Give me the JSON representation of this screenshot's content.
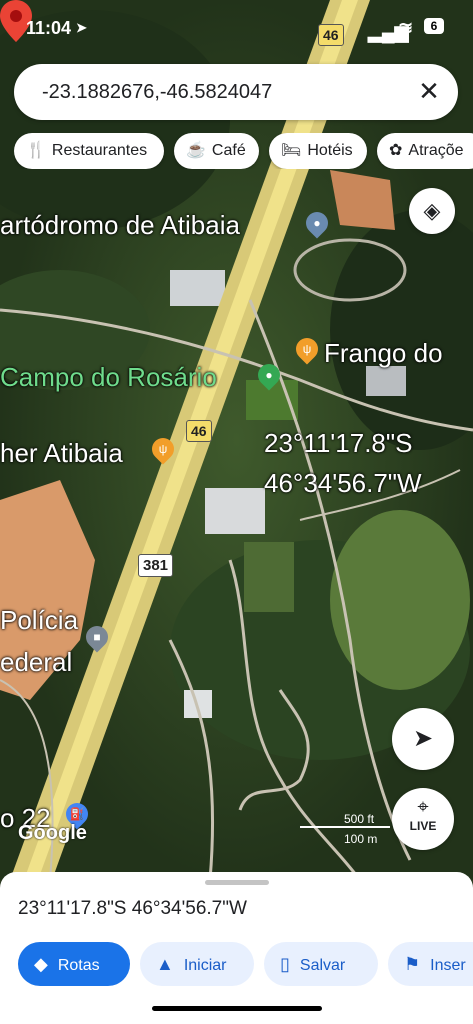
{
  "status_bar": {
    "time": "11:04",
    "battery": "6"
  },
  "search": {
    "query": "-23.1882676,-46.5824047",
    "clear_icon": "close-icon"
  },
  "chips": [
    {
      "label": "Restaurantes",
      "icon": "fork-knife-icon"
    },
    {
      "label": "Café",
      "icon": "coffee-icon"
    },
    {
      "label": "Hotéis",
      "icon": "bed-icon"
    },
    {
      "label": "Atraçõe",
      "icon": "attraction-icon"
    }
  ],
  "map": {
    "labels": {
      "kartodromo": "artódromo de Atibaia",
      "frango": "Frango do",
      "campo": "Campo do Rosário",
      "atibaia": "her Atibaia",
      "policia_1": "Polícia",
      "policia_2": "ederal",
      "posto": "o 22"
    },
    "shields": {
      "top": "46",
      "mid": "46",
      "br381": "381"
    },
    "pin_label_lat": "23°11'17.8\"S",
    "pin_label_lon": "46°34'56.7\"W",
    "scale_ft": "500 ft",
    "scale_m": "100 m",
    "attribution": "Google",
    "live_label": "LIVE"
  },
  "sheet": {
    "coordinates": "23°11'17.8\"S 46°34'56.7\"W",
    "actions": [
      {
        "label": "Rotas",
        "icon": "directions-icon"
      },
      {
        "label": "Iniciar",
        "icon": "navigation-icon"
      },
      {
        "label": "Salvar",
        "icon": "bookmark-icon"
      },
      {
        "label": "Inser",
        "icon": "flag-icon"
      }
    ]
  },
  "colors": {
    "accent": "#1a73e8",
    "pin": "#ea4335",
    "road": "#f0e28a"
  }
}
